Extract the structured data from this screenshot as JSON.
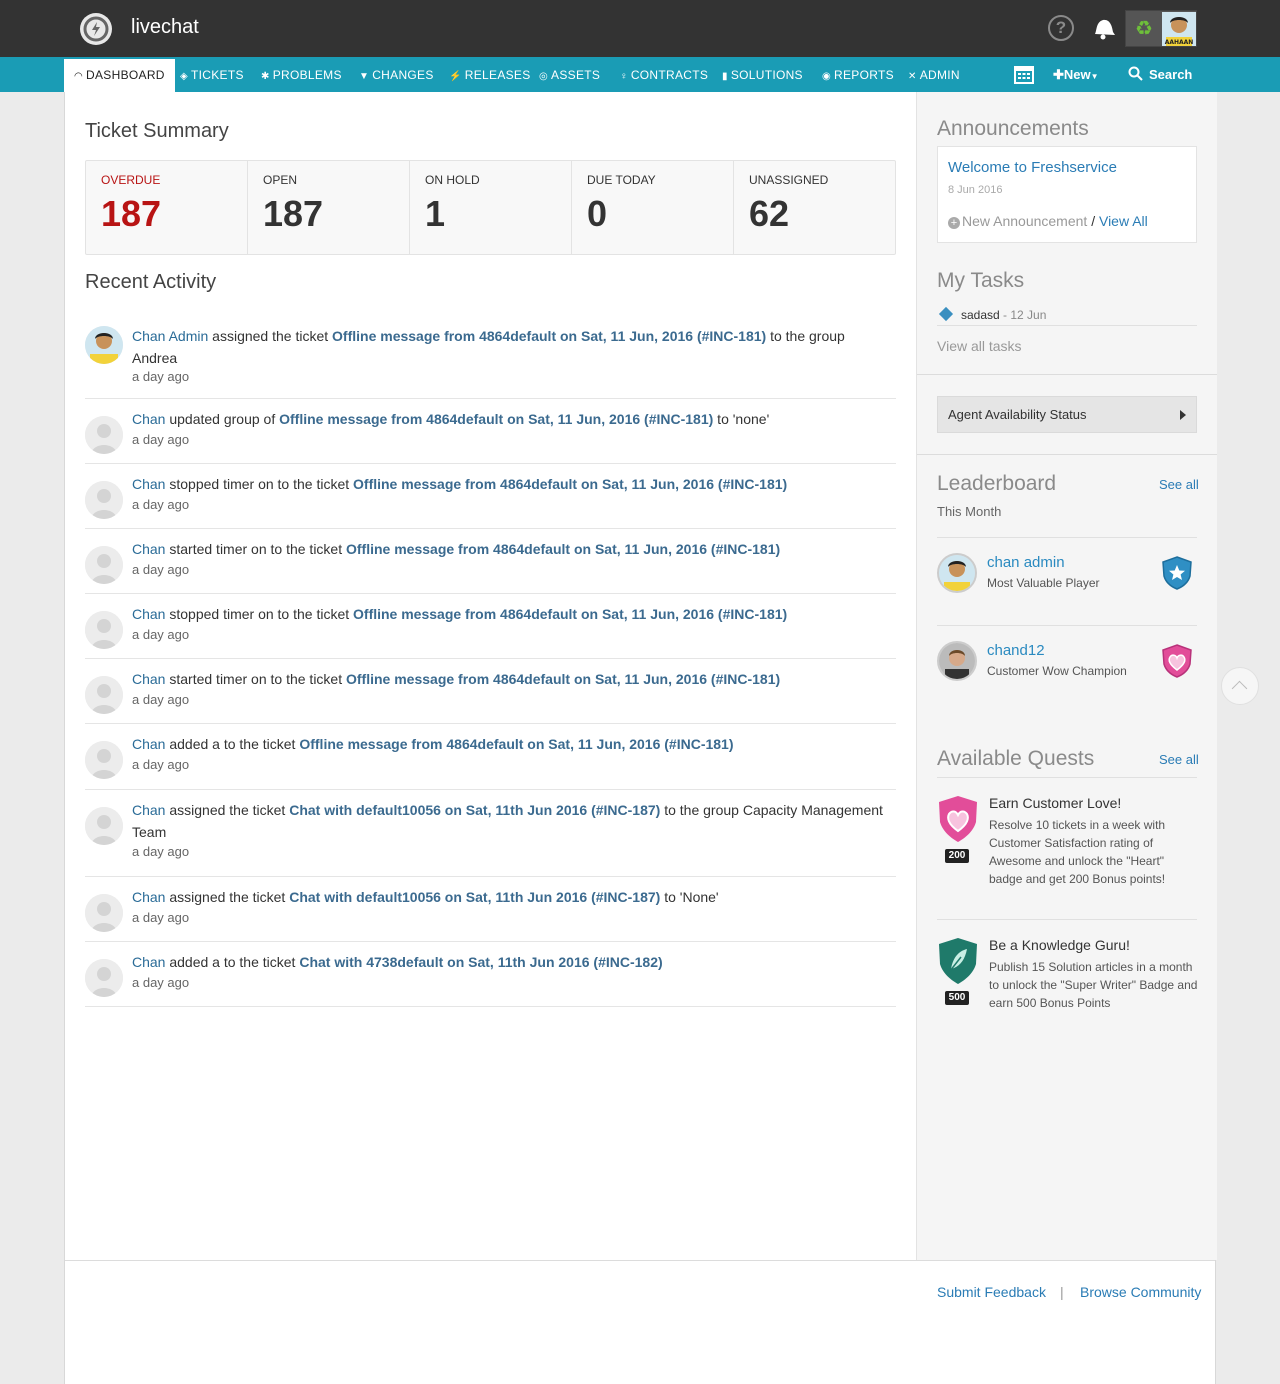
{
  "header": {
    "app_title": "livechat",
    "help_icon": "question-circle-icon",
    "bell_icon": "bell-icon",
    "user_avatar_text": "AAHAAN"
  },
  "nav": {
    "items": [
      {
        "label": "DASHBOARD",
        "icon": "dashboard-icon"
      },
      {
        "label": "TICKETS",
        "icon": "ticket-icon"
      },
      {
        "label": "PROBLEMS",
        "icon": "bug-icon"
      },
      {
        "label": "CHANGES",
        "icon": "changes-icon"
      },
      {
        "label": "RELEASES",
        "icon": "lightning-icon"
      },
      {
        "label": "ASSETS",
        "icon": "asset-icon"
      },
      {
        "label": "CONTRACTS",
        "icon": "pin-icon"
      },
      {
        "label": "SOLUTIONS",
        "icon": "book-icon"
      },
      {
        "label": "REPORTS",
        "icon": "pie-icon"
      },
      {
        "label": "ADMIN",
        "icon": "tools-icon"
      }
    ],
    "new_label": "New",
    "search_label": "Search"
  },
  "summary": {
    "title": "Ticket Summary",
    "cards": [
      {
        "label": "OVERDUE",
        "value": "187"
      },
      {
        "label": "OPEN",
        "value": "187"
      },
      {
        "label": "ON HOLD",
        "value": "1"
      },
      {
        "label": "DUE TODAY",
        "value": "0"
      },
      {
        "label": "UNASSIGNED",
        "value": "62"
      }
    ]
  },
  "activity": {
    "title": "Recent Activity",
    "items": [
      {
        "actor": "Chan Admin",
        "pre": " assigned the ticket ",
        "link": "Offline message from 4864default on Sat, 11 Jun, 2016 (#INC-181)",
        "post": " to the group Andrea",
        "time": "a day ago"
      },
      {
        "actor": "Chan",
        "pre": " updated group of ",
        "link": "Offline message from 4864default on Sat, 11 Jun, 2016 (#INC-181)",
        "post": " to 'none'",
        "time": "a day ago"
      },
      {
        "actor": "Chan",
        "pre": " stopped timer on to the ticket ",
        "link": "Offline message from 4864default on Sat, 11 Jun, 2016 (#INC-181)",
        "post": "",
        "time": "a day ago"
      },
      {
        "actor": "Chan",
        "pre": " started timer on to the ticket ",
        "link": "Offline message from 4864default on Sat, 11 Jun, 2016 (#INC-181)",
        "post": "",
        "time": "a day ago"
      },
      {
        "actor": "Chan",
        "pre": " stopped timer on to the ticket ",
        "link": "Offline message from 4864default on Sat, 11 Jun, 2016 (#INC-181)",
        "post": "",
        "time": "a day ago"
      },
      {
        "actor": "Chan",
        "pre": " started timer on to the ticket ",
        "link": "Offline message from 4864default on Sat, 11 Jun, 2016 (#INC-181)",
        "post": "",
        "time": "a day ago"
      },
      {
        "actor": "Chan",
        "pre": " added a to the ticket ",
        "link": "Offline message from 4864default on Sat, 11 Jun, 2016 (#INC-181)",
        "post": "",
        "time": "a day ago"
      },
      {
        "actor": "Chan",
        "pre": " assigned the ticket ",
        "link": "Chat with default10056 on Sat, 11th Jun 2016 (#INC-187)",
        "post": " to the group Capacity Management Team",
        "time": "a day ago"
      },
      {
        "actor": "Chan",
        "pre": " assigned the ticket ",
        "link": "Chat with default10056 on Sat, 11th Jun 2016 (#INC-187)",
        "post": " to 'None'",
        "time": "a day ago"
      },
      {
        "actor": "Chan",
        "pre": " added a to the ticket ",
        "link": "Chat with 4738default on Sat, 11th Jun 2016 (#INC-182)",
        "post": "",
        "time": "a day ago"
      }
    ]
  },
  "sidebar": {
    "announcements": {
      "title": "Announcements",
      "item_title": "Welcome to Freshservice",
      "item_date": "8 Jun 2016",
      "new_label": "New Announcement",
      "sep": " / ",
      "view_all": "View All"
    },
    "tasks": {
      "title": "My Tasks",
      "task_name": "sadasd",
      "task_sep": " - ",
      "task_date": "12 Jun",
      "view_all": "View all tasks"
    },
    "agent_status": "Agent Availability Status",
    "leaderboard": {
      "title": "Leaderboard",
      "see_all": "See all",
      "subtitle": "This Month",
      "rows": [
        {
          "name": "chan admin",
          "title": "Most Valuable Player",
          "badge_color": "#2f8fc4"
        },
        {
          "name": "chand12",
          "title": "Customer Wow Champion",
          "badge_color": "#e24d99"
        }
      ]
    },
    "quests": {
      "title": "Available Quests",
      "see_all": "See all",
      "rows": [
        {
          "title": "Earn Customer Love!",
          "desc": "Resolve 10 tickets in a week with Customer Satisfaction rating of Awesome and unlock the \"Heart\" badge and get 200 Bonus points!",
          "points": "200"
        },
        {
          "title": "Be a Knowledge Guru!",
          "desc": "Publish 15 Solution articles in a month to unlock the \"Super Writer\" Badge and earn 500 Bonus Points",
          "points": "500"
        }
      ]
    }
  },
  "footer": {
    "feedback": "Submit Feedback",
    "sep": "|",
    "community": "Browse Community"
  }
}
